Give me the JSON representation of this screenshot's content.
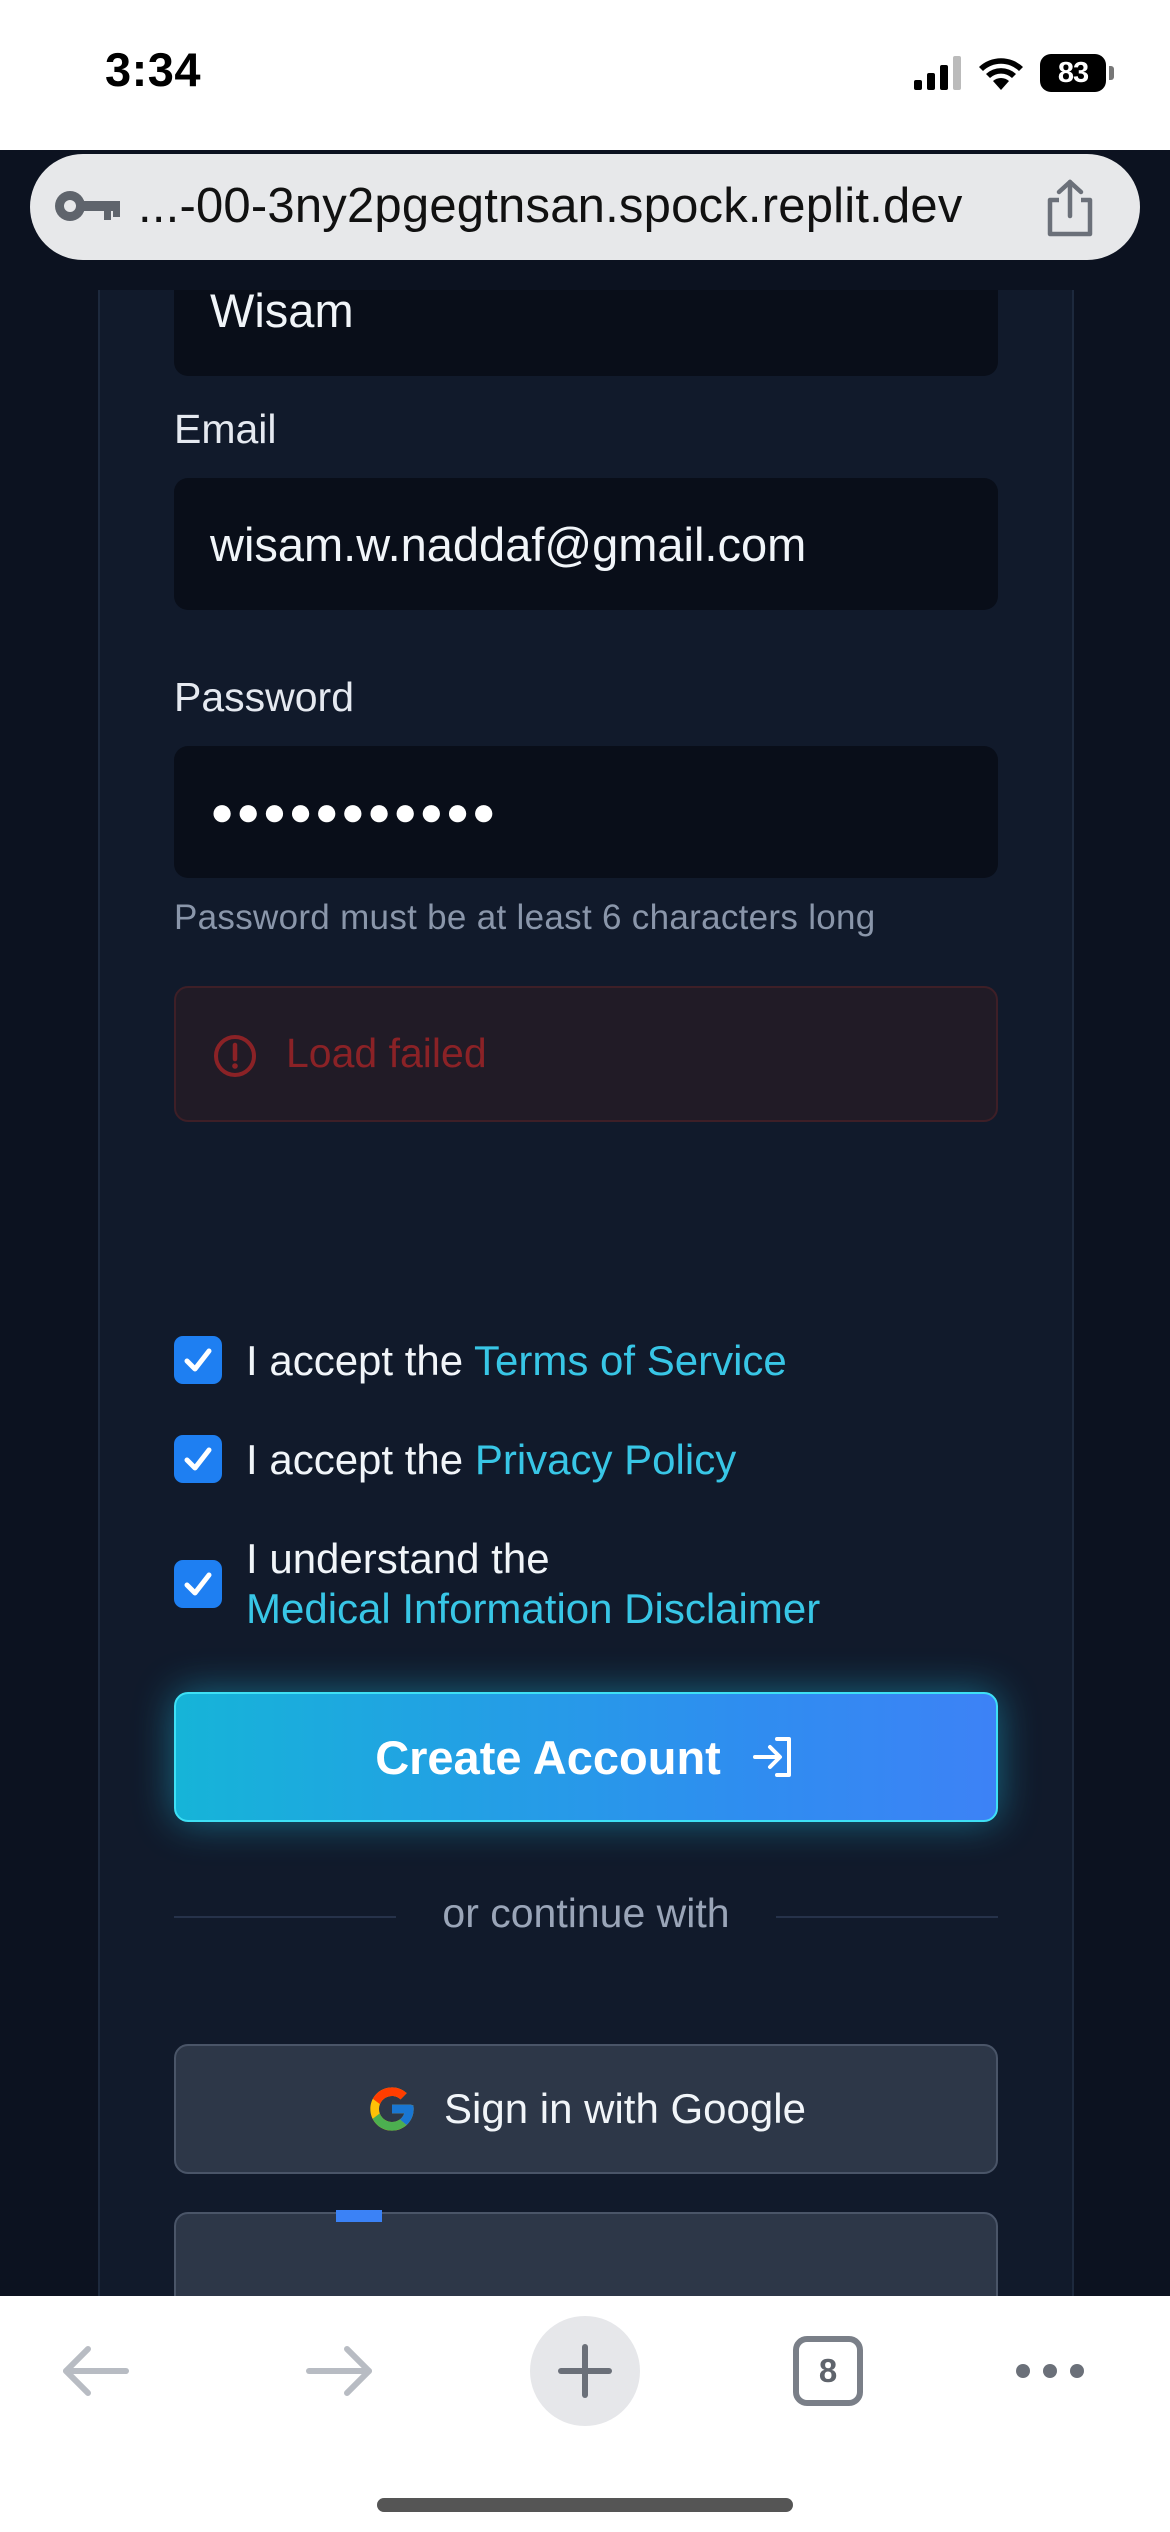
{
  "status_bar": {
    "time": "3:34",
    "battery": "83"
  },
  "address_bar": {
    "url": "...-00-3ny2pgegtnsan.spock.replit.dev"
  },
  "form": {
    "name_value": "Wisam",
    "email_label": "Email",
    "email_value": "wisam.w.naddaf@gmail.com",
    "password_label": "Password",
    "password_masked": "●●●●●●●●●●●",
    "password_hint": "Password must be at least 6 characters long",
    "error_message": "Load failed"
  },
  "consents": {
    "terms_prefix": "I accept the ",
    "terms_link": "Terms of Service",
    "privacy_prefix": "I accept the ",
    "privacy_link": "Privacy Policy",
    "disclaimer_prefix": "I understand the",
    "disclaimer_link": "Medical Information Disclaimer"
  },
  "actions": {
    "create_account_label": "Create Account",
    "divider_text": "or continue with",
    "google_label": "Sign in with Google"
  },
  "toolbar": {
    "tab_count": "8"
  },
  "colors": {
    "accent_link": "#38c6e6",
    "button_gradient_start": "#16b4d8",
    "button_gradient_end": "#3d82f6",
    "error_text": "#8b2226",
    "checkbox": "#1e7ff2"
  }
}
